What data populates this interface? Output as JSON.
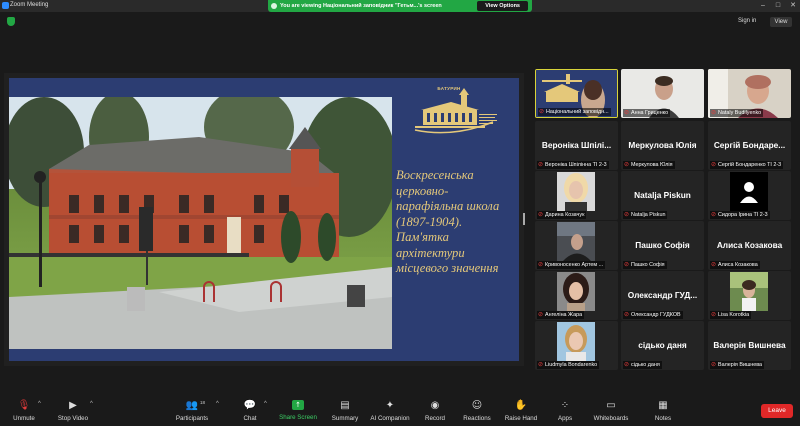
{
  "window": {
    "title": "Zoom Meeting"
  },
  "share_banner": {
    "text": "You are viewing Національний заповідник \"Гетьм...'s screen",
    "view_options": "View Options"
  },
  "topbar": {
    "sign_in": "Sign in",
    "view": "View"
  },
  "slide": {
    "logo_title": "БАТУРИН",
    "caption_lines": [
      "Воскресенська",
      "церковно-",
      "парафіяльна школа",
      "(1897-1904).",
      "Пам'ятка",
      "архітектури",
      "місцевого значення"
    ]
  },
  "gallery": [
    {
      "label": "Національний заповідн...",
      "name": "",
      "kind": "logo",
      "active": true
    },
    {
      "label": "Анна Гриценко",
      "name": "",
      "kind": "video-young-man"
    },
    {
      "label": "Nataly Budilyenko",
      "name": "",
      "kind": "video-older-woman"
    },
    {
      "label": "Вероніка Шпілінна ТІ 2-3",
      "name": "Вероніка Шпілі..."
    },
    {
      "label": "Меркулова Юлія",
      "name": "Меркулова Юлія"
    },
    {
      "label": "Сергій Бондаренко ТІ 2-3",
      "name": "Сергій Бондаре..."
    },
    {
      "label": "Дарина Козачук",
      "name": "",
      "kind": "photo-girl-blonde"
    },
    {
      "label": "Natalja Piskun",
      "name": "Natalja Piskun"
    },
    {
      "label": "Сидора Ірина ТІ 2-3",
      "name": "",
      "kind": "avatar-black"
    },
    {
      "label": "Кривоносенко Артем ...",
      "name": "",
      "kind": "photo-dark"
    },
    {
      "label": "Пашко Софія",
      "name": "Пашко Софія"
    },
    {
      "label": "Алиса Козакова",
      "name": "Алиса Козакова"
    },
    {
      "label": "Ангеліна Жара",
      "name": "",
      "kind": "photo-girl-dark"
    },
    {
      "label": "Олександр ГУДКОВ",
      "name": "Олександр ГУД..."
    },
    {
      "label": "Lisa Korotkia",
      "name": "",
      "kind": "photo-outdoor"
    },
    {
      "label": "Liudmyla Bondarenko",
      "name": "",
      "kind": "photo-woman"
    },
    {
      "label": "сідько даня",
      "name": "сідько даня"
    },
    {
      "label": "Валерія Вишнева",
      "name": "Валерія Вишнева"
    }
  ],
  "toolbar": {
    "unmute": "Unmute",
    "stop_video": "Stop Video",
    "participants": "Participants",
    "participants_count": "18",
    "chat": "Chat",
    "share_screen": "Share Screen",
    "summary": "Summary",
    "ai_companion": "AI Companion",
    "record": "Record",
    "reactions": "Reactions",
    "raise_hand": "Raise Hand",
    "apps": "Apps",
    "whiteboards": "Whiteboards",
    "notes": "Notes",
    "leave": "Leave"
  },
  "colors": {
    "share_green": "#22a744",
    "slide_bg": "#2c3d72",
    "slide_text": "#e4c87a",
    "leave_red": "#e02828",
    "active_border": "#d8d43a",
    "mute_red": "#e23b3b"
  },
  "icons": [
    "shield-icon",
    "microphone-muted-icon",
    "video-camera-icon",
    "participants-icon",
    "chat-icon",
    "share-screen-icon",
    "summary-icon",
    "ai-companion-icon",
    "record-icon",
    "reactions-icon",
    "raise-hand-icon",
    "apps-icon",
    "whiteboards-icon",
    "notes-icon"
  ]
}
